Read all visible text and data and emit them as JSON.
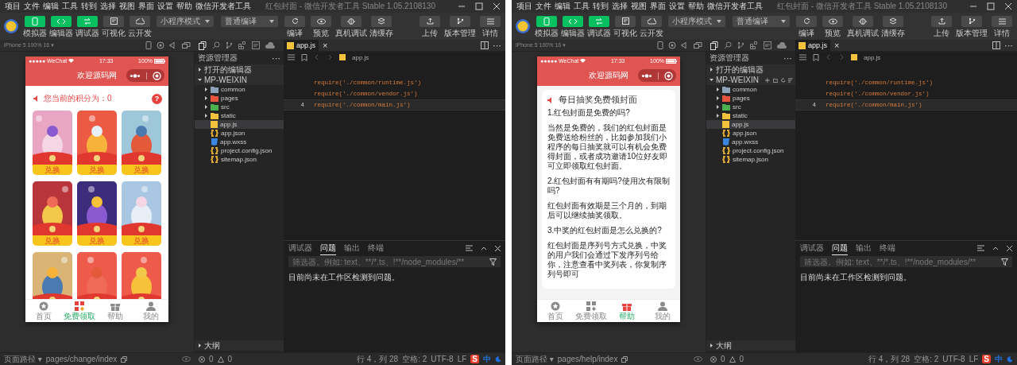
{
  "windows": [
    {
      "menu": [
        "项目",
        "文件",
        "编辑",
        "工具",
        "转到",
        "选择",
        "视图",
        "界面",
        "设置",
        "帮助",
        "微信开发者工具"
      ],
      "title": "红包封面 - 微信开发者工具 Stable 1.05.2108130",
      "view_toggles": [
        {
          "label": "模拟器",
          "on": true
        },
        {
          "label": "编辑器",
          "on": true
        },
        {
          "label": "调试器",
          "on": true
        },
        {
          "label": "可视化",
          "on": false
        },
        {
          "label": "云开发",
          "on": false
        }
      ],
      "mode_select": "小程序模式",
      "compile_select": "普通编译",
      "actions": [
        "编译",
        "预览",
        "真机调试",
        "清缓存"
      ],
      "right_actions": [
        "上传",
        "版本管理",
        "详情"
      ],
      "device": "iPhone 5 100% 16 ▾",
      "phone": {
        "kind": "grid",
        "carrier": "●●●●● WeChat",
        "time": "17:33",
        "battery": "100%",
        "nav_title": "欢迎源码网",
        "points": "您当前的积分为：0",
        "help_glyph": "?",
        "cards": [
          {
            "kind": "picture",
            "button": "兑换"
          },
          {
            "kind": "picture",
            "button": "兑换"
          },
          {
            "kind": "picture",
            "button": "兑换"
          },
          {
            "kind": "picture",
            "button": "兑换"
          },
          {
            "kind": "picture",
            "button": "兑换"
          },
          {
            "kind": "picture",
            "button": "兑换"
          },
          {
            "kind": "picture"
          },
          {
            "kind": "picture"
          },
          {
            "kind": "picture"
          }
        ],
        "tabs": [
          {
            "label": "首页",
            "selected": false
          },
          {
            "label": "免费领取",
            "selected": true
          },
          {
            "label": "帮助",
            "selected": false
          },
          {
            "label": "我的",
            "selected": false
          }
        ]
      },
      "explorer": {
        "title": "资源管理器",
        "more": "···",
        "open_editors": "打开的编辑器",
        "open_expanded": false,
        "project": "MP-WEIXIN",
        "project_expanded": true,
        "project_actions": false,
        "outline": "大纲",
        "files": [
          {
            "name": "common",
            "kind": "folder",
            "color": "#8fa3b8",
            "selected": false
          },
          {
            "name": "pages",
            "kind": "folder",
            "color": "#e8553f",
            "selected": false
          },
          {
            "name": "src",
            "kind": "folder",
            "color": "#4caf50",
            "selected": false
          },
          {
            "name": "static",
            "kind": "folder",
            "color": "#f2c23c",
            "selected": false
          },
          {
            "name": "app.js",
            "kind": "js",
            "color": "#f2c23c",
            "selected": true
          },
          {
            "name": "app.json",
            "kind": "json",
            "color": "#d9a632",
            "selected": false
          },
          {
            "name": "app.wxss",
            "kind": "css",
            "color": "#3b86de",
            "selected": false
          },
          {
            "name": "project.config.json",
            "kind": "json",
            "color": "#d9a632",
            "selected": false
          },
          {
            "name": "sitemap.json",
            "kind": "json",
            "color": "#d9a632",
            "selected": false
          }
        ]
      },
      "editor": {
        "tab": "app.js",
        "close": "×",
        "breadcrumb": "app.js",
        "more": "···",
        "lines": [
          {
            "selected": false
          },
          {
            "code": "require('./common/runtime.js')",
            "selected": false
          },
          {
            "code": "require('./common/vendor.js')",
            "selected": false
          },
          {
            "number": "4",
            "code": "require('./common/main.js')",
            "selected": true
          }
        ]
      },
      "panel": {
        "tabs": [
          {
            "label": "调试器",
            "selected": false
          },
          {
            "label": "问题",
            "selected": true
          },
          {
            "label": "输出",
            "selected": false
          },
          {
            "label": "终端",
            "selected": false
          }
        ],
        "filter_placeholder": "筛选器。例如: text、**/*.ts、!**/node_modules/**",
        "message": "目前尚未在工作区检测到问题。"
      },
      "status": {
        "path_label": "页面路径 ▾",
        "path": "pages/change/index",
        "errors": "0",
        "warnings": "0",
        "position": "行 4，列 28",
        "indent": "空格: 2",
        "encoding": "UTF-8",
        "eol": "LF",
        "ime_logo": "S",
        "ime_mode": "中"
      }
    },
    {
      "menu": [
        "项目",
        "文件",
        "编辑",
        "工具",
        "转到",
        "选择",
        "视图",
        "界面",
        "设置",
        "帮助",
        "微信开发者工具"
      ],
      "title": "红包封面 - 微信开发者工具 Stable 1.05.2108130",
      "view_toggles": [
        {
          "label": "模拟器",
          "on": true
        },
        {
          "label": "编辑器",
          "on": true
        },
        {
          "label": "调试器",
          "on": true
        },
        {
          "label": "可视化",
          "on": false
        },
        {
          "label": "云开发",
          "on": false
        }
      ],
      "mode_select": "小程序模式",
      "compile_select": "普通编译",
      "actions": [
        "编译",
        "预览",
        "真机调试",
        "清缓存"
      ],
      "right_actions": [
        "上传",
        "版本管理",
        "详情"
      ],
      "device": "iPhone 5 100% 16 ▾",
      "phone": {
        "kind": "faq",
        "carrier": "●●●●● WeChat",
        "time": "17:33",
        "battery": "100%",
        "nav_title": "欢迎源码网",
        "faq_title": "每日抽奖免费领封面",
        "paragraphs": [
          {
            "kind": "question",
            "text": "1.红包封面是免费的吗?"
          },
          {
            "kind": "answer",
            "text": "当然是免费的，我们的红包封面是免费送给粉丝的，比如参加我们小程序的每日抽奖就可以有机会免费得封面，或者成功邀请10位好友即可立即领取红包封面。"
          },
          {
            "kind": "question",
            "text": "2.红包封面有有期吗?使用次有限制吗?"
          },
          {
            "kind": "answer",
            "text": "红包封面有效期是三个月的，到期后可以继续抽奖领取。"
          },
          {
            "kind": "question",
            "text": "3.中奖的红包封面是怎么兑换的?"
          },
          {
            "kind": "answer",
            "text": "红包封面是序列号方式兑换，中奖的用户我们会通过下发序列号给你，注意查看中奖列表，你复制序列号即可"
          }
        ],
        "tabs": [
          {
            "label": "首页",
            "selected": false
          },
          {
            "label": "免费领取",
            "selected": false
          },
          {
            "label": "帮助",
            "selected": true
          },
          {
            "label": "我的",
            "selected": false
          }
        ]
      },
      "explorer": {
        "title": "资源管理器",
        "more": "···",
        "open_editors": "打开的编辑器",
        "open_expanded": false,
        "project": "MP-WEIXIN",
        "project_expanded": true,
        "project_actions": true,
        "outline": "大纲",
        "files": [
          {
            "name": "common",
            "kind": "folder",
            "color": "#8fa3b8",
            "selected": false
          },
          {
            "name": "pages",
            "kind": "folder",
            "color": "#e8553f",
            "selected": false
          },
          {
            "name": "src",
            "kind": "folder",
            "color": "#4caf50",
            "selected": false
          },
          {
            "name": "static",
            "kind": "folder",
            "color": "#f2c23c",
            "selected": false
          },
          {
            "name": "app.js",
            "kind": "js",
            "color": "#f2c23c",
            "selected": true
          },
          {
            "name": "app.json",
            "kind": "json",
            "color": "#d9a632",
            "selected": false
          },
          {
            "name": "app.wxss",
            "kind": "css",
            "color": "#3b86de",
            "selected": false
          },
          {
            "name": "project.config.json",
            "kind": "json",
            "color": "#d9a632",
            "selected": false
          },
          {
            "name": "sitemap.json",
            "kind": "json",
            "color": "#d9a632",
            "selected": false
          }
        ]
      },
      "editor": {
        "tab": "app.js",
        "close": "×",
        "breadcrumb": "app.js",
        "more": "···",
        "lines": [
          {
            "selected": false
          },
          {
            "code": "require('./common/runtime.js')",
            "selected": false
          },
          {
            "code": "require('./common/vendor.js')",
            "selected": false
          },
          {
            "number": "4",
            "code": "require('./common/main.js')",
            "selected": true
          }
        ]
      },
      "panel": {
        "tabs": [
          {
            "label": "调试器",
            "selected": false
          },
          {
            "label": "问题",
            "selected": true
          },
          {
            "label": "输出",
            "selected": false
          },
          {
            "label": "终端",
            "selected": false
          }
        ],
        "filter_placeholder": "筛选器。例如: text、**/*.ts、!**/node_modules/**",
        "message": "目前尚未在工作区检测到问题。"
      },
      "status": {
        "path_label": "页面路径 ▾",
        "path": "pages/help/index",
        "errors": "0",
        "warnings": "0",
        "position": "行 4，列 28",
        "indent": "空格: 2",
        "encoding": "UTF-8",
        "eol": "LF",
        "ime_logo": "S",
        "ime_mode": "中"
      }
    }
  ]
}
